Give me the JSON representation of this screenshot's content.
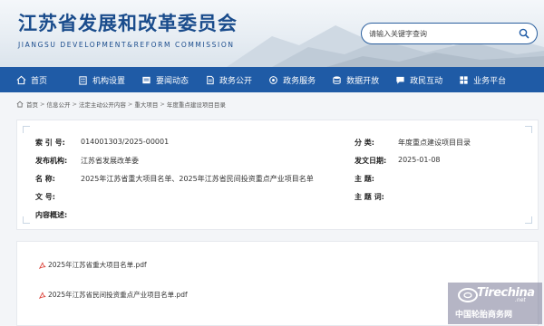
{
  "header": {
    "site_title_cn": "江苏省发展和改革委员会",
    "site_title_en": "JIANGSU DEVELOPMENT&REFORM COMMISSION",
    "search_placeholder": "请输入关键字查询"
  },
  "nav": {
    "items": [
      {
        "label": "首页",
        "icon": "home-icon"
      },
      {
        "label": "机构设置",
        "icon": "building-icon"
      },
      {
        "label": "要闻动态",
        "icon": "news-icon"
      },
      {
        "label": "政务公开",
        "icon": "document-icon"
      },
      {
        "label": "政务服务",
        "icon": "service-icon"
      },
      {
        "label": "数据开放",
        "icon": "data-icon"
      },
      {
        "label": "政民互动",
        "icon": "chat-icon"
      },
      {
        "label": "业务平台",
        "icon": "platform-icon"
      }
    ]
  },
  "breadcrumb": [
    "首页",
    "信息公开",
    "法定主动公开内容",
    "重大项目",
    "年度重点建设项目目录"
  ],
  "meta": {
    "index_label": "索 引 号:",
    "index_value": "014001303/2025-00001",
    "category_label": "分 类:",
    "category_value": "年度重点建设项目目录",
    "issuer_label": "发布机构:",
    "issuer_value": "江苏省发展改革委",
    "date_label": "发文日期:",
    "date_value": "2025-01-08",
    "name_label": "名 称:",
    "name_value": "2025年江苏省重大项目名单、2025年江苏省民间投资重点产业项目名单",
    "subject_label": "主 题:",
    "subject_value": "",
    "docno_label": "文 号:",
    "docno_value": "",
    "keywords_label": "主 题 词:",
    "keywords_value": "",
    "summary_label": "内容概述:",
    "summary_value": ""
  },
  "attachments": [
    {
      "name": "2025年江苏省重大项目名单.pdf"
    },
    {
      "name": "2025年江苏省民间投资重点产业项目名单.pdf"
    }
  ],
  "watermark": {
    "brand": "Tirechina",
    "domain_suffix": ".net",
    "text": "中国轮胎商务网"
  },
  "colors": {
    "nav_bg": "#1f5ba6",
    "title_blue": "#1a4c8c",
    "pdf_red": "#d9352b"
  }
}
